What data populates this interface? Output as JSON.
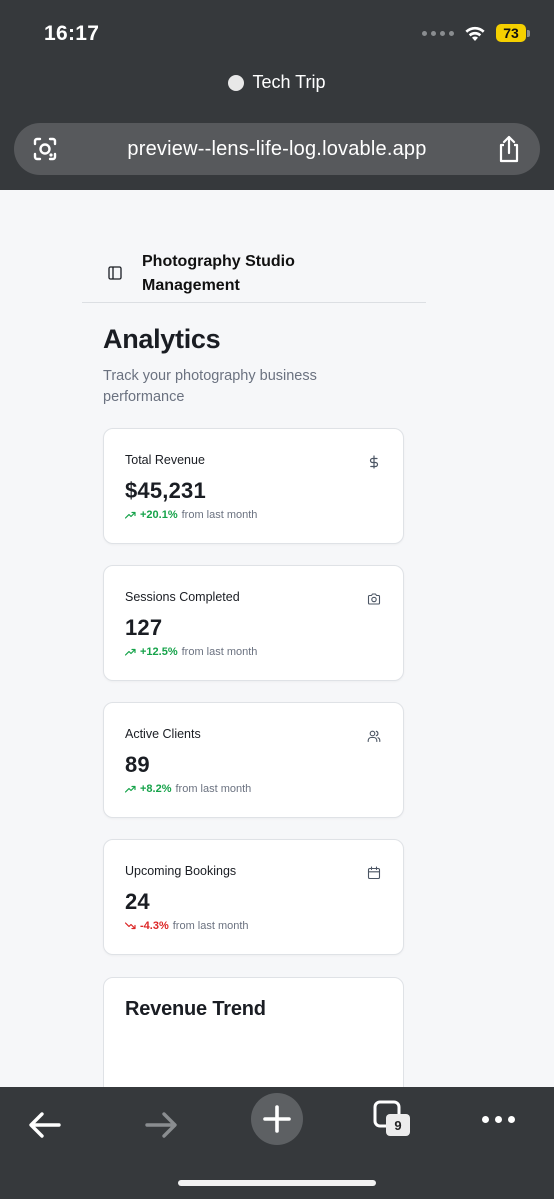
{
  "status_bar": {
    "time": "16:17",
    "battery": "73"
  },
  "browser": {
    "tab_title": "Tech Trip",
    "url": "preview--lens-life-log.lovable.app",
    "tab_count": "9"
  },
  "app": {
    "brand": "Photography Studio Management",
    "page_title": "Analytics",
    "page_subtitle": "Track your photography business performance"
  },
  "cards": [
    {
      "label": "Total Revenue",
      "value": "$45,231",
      "delta": "+20.1%",
      "suffix": "from last month",
      "trend": "up",
      "icon": "dollar-icon"
    },
    {
      "label": "Sessions Completed",
      "value": "127",
      "delta": "+12.5%",
      "suffix": "from last month",
      "trend": "up",
      "icon": "camera-icon"
    },
    {
      "label": "Active Clients",
      "value": "89",
      "delta": "+8.2%",
      "suffix": "from last month",
      "trend": "up",
      "icon": "users-icon"
    },
    {
      "label": "Upcoming Bookings",
      "value": "24",
      "delta": "-4.3%",
      "suffix": "from last month",
      "trend": "down",
      "icon": "calendar-icon"
    }
  ],
  "chart_section": {
    "title": "Revenue Trend"
  },
  "colors": {
    "up": "#16a34a",
    "down": "#dc2626",
    "chrome": "#36393c",
    "battery": "#f5d000"
  }
}
